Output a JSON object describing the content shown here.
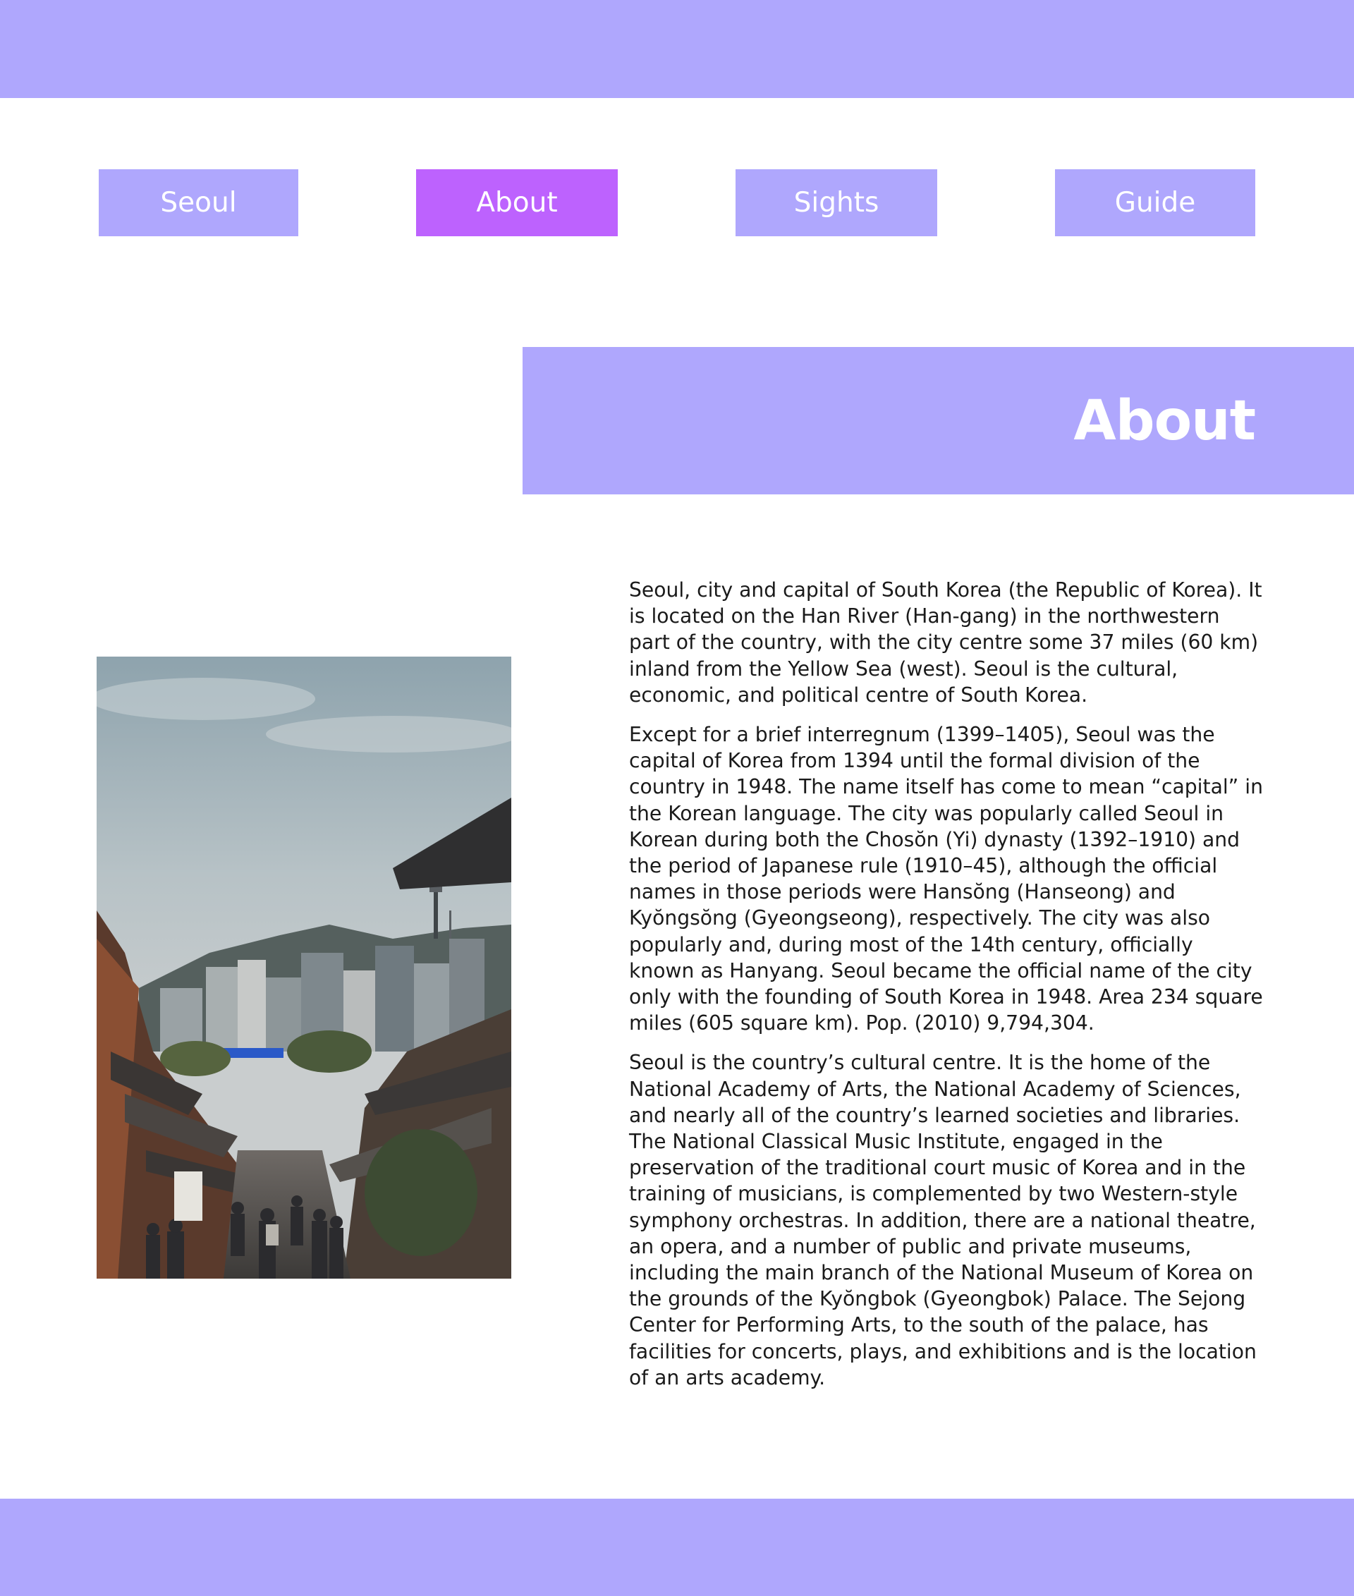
{
  "nav": {
    "items": [
      {
        "label": "Seoul"
      },
      {
        "label": "About"
      },
      {
        "label": "Sights"
      },
      {
        "label": "Guide"
      }
    ],
    "active": "About"
  },
  "section": {
    "title": "About"
  },
  "article": {
    "paragraphs": [
      "Seoul, city and capital of South Korea (the Republic of Korea). It is located on the Han River (Han-gang) in the northwestern part of the country, with the city centre some 37 miles (60 km) inland from the Yellow Sea (west). Seoul is the cultural, economic, and political centre of South Korea.",
      "Except for a brief interregnum (1399–1405), Seoul was the capital of Korea from 1394 until the formal division of the country in 1948. The name itself has come to mean “capital” in the Korean language. The city was popularly called Seoul in Korean during both the Chosŏn (Yi) dynasty (1392–1910) and the period of Japanese rule (1910–45), although the official names in those periods were Hansŏng (Hanseong) and Kyŏngsŏng (Gyeongseong), respectively. The city was also popularly and, during most of the 14th century, officially known as Hanyang. Seoul became the official name of the city only with the founding of South Korea in 1948. Area 234 square miles (605 square km). Pop. (2010) 9,794,304.",
      "Seoul is the country’s cultural centre. It is the home of the National Academy of Arts, the National Academy of Sciences, and nearly all of the country’s learned societies and libraries. The National Classical Music Institute, engaged in the preservation of the traditional court music of Korea and in the training of musicians, is complemented by two Western-style symphony orchestras. In addition, there are a national theatre, an opera, and a number of public and private museums, including the main branch of the National Museum of Korea on the grounds of the Kyŏngbok (Gyeongbok) Palace. The Sejong Center for Performing Arts, to the south of the palace, has facilities for concerts, plays, and exhibitions and is the location of an arts academy."
    ]
  },
  "colors": {
    "bar": "#afa7fd",
    "nav_active": "#bd62fe",
    "text": "#1a1a1a"
  }
}
